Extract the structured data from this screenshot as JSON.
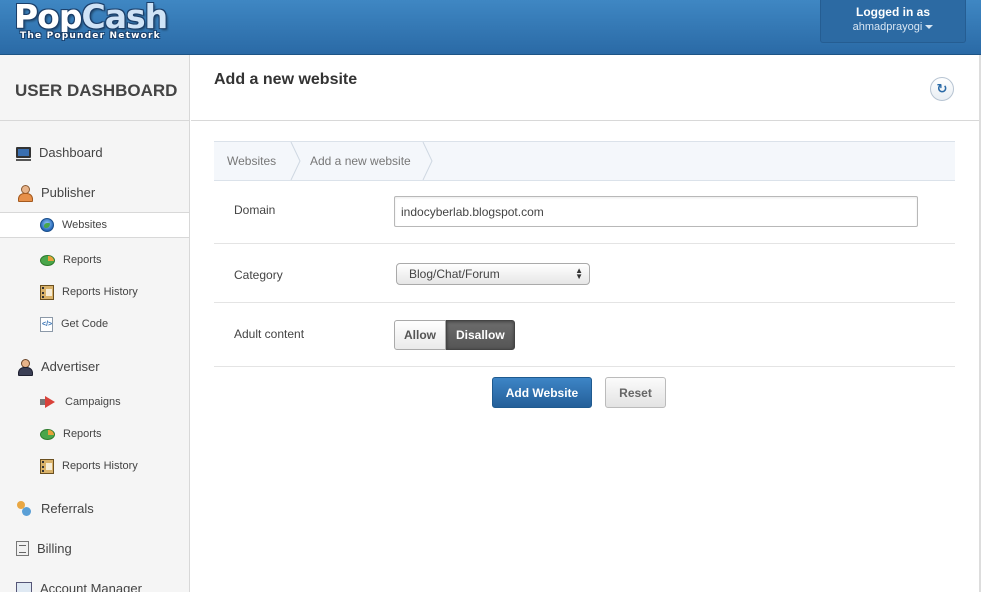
{
  "header": {
    "logo_main_a": "Pop",
    "logo_main_b": "Cash",
    "logo_sub": "The Popunder Network",
    "user_title": "Logged in as",
    "username": "ahmadprayogi"
  },
  "sidebar": {
    "title": "USER DASHBOARD",
    "items": [
      {
        "label": "Dashboard",
        "icon": "monitor-icon"
      },
      {
        "label": "Publisher",
        "icon": "person-icon"
      },
      {
        "label": "Websites",
        "icon": "globe-icon",
        "active": true
      },
      {
        "label": "Reports",
        "icon": "pie-chart-icon"
      },
      {
        "label": "Reports History",
        "icon": "ledger-icon"
      },
      {
        "label": "Get Code",
        "icon": "code-icon"
      },
      {
        "label": "Advertiser",
        "icon": "person-icon"
      },
      {
        "label": "Campaigns",
        "icon": "megaphone-icon"
      },
      {
        "label": "Reports",
        "icon": "pie-chart-icon"
      },
      {
        "label": "Reports History",
        "icon": "ledger-icon"
      },
      {
        "label": "Referrals",
        "icon": "people-icon"
      },
      {
        "label": "Billing",
        "icon": "bill-icon"
      },
      {
        "label": "Account Manager",
        "icon": "id-card-icon"
      }
    ]
  },
  "main": {
    "title": "Add a new website",
    "breadcrumb": [
      "Websites",
      "Add a new website"
    ],
    "form": {
      "domain_label": "Domain",
      "domain_value": "indocyberlab.blogspot.com",
      "category_label": "Category",
      "category_value": "Blog/Chat/Forum",
      "adult_label": "Adult content",
      "adult_allow": "Allow",
      "adult_disallow": "Disallow",
      "adult_selected": "Disallow",
      "submit_label": "Add Website",
      "reset_label": "Reset"
    }
  },
  "colors": {
    "header_blue": "#2f74b3",
    "primary_button": "#2c6aa6",
    "toggle_active": "#5e5e5e"
  }
}
